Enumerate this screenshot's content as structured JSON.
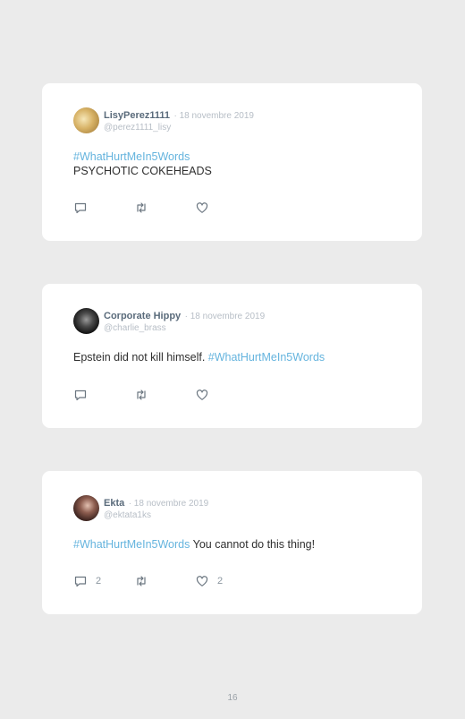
{
  "tweets": [
    {
      "name": "LisyPerez1111",
      "date": "· 18 novembre 2019",
      "handle": "@perez1111_lisy",
      "hashtag": "#WhatHurtMeIn5Words",
      "text": "PSYCHOTIC COKEHEADS",
      "reply_count": "",
      "like_count": ""
    },
    {
      "name": "Corporate Hippy",
      "date": "· 18 novembre 2019",
      "handle": "@charlie_brass",
      "text": "Epstein did not kill himself.",
      "hashtag": "#WhatHurtMeIn5Words",
      "reply_count": "",
      "like_count": ""
    },
    {
      "name": "Ekta",
      "date": "· 18 novembre 2019",
      "handle": "@ektata1ks",
      "hashtag": "#WhatHurtMeIn5Words",
      "text": "You cannot do this thing!",
      "reply_count": "2",
      "like_count": "2"
    }
  ],
  "icons": {
    "reply": "reply-icon",
    "retweet": "retweet-icon",
    "like": "like-icon"
  },
  "colors": {
    "background": "#ebebeb",
    "card": "#ffffff",
    "hashtag": "#65b4de",
    "name": "#5a6b7b",
    "muted": "#b7bec6"
  },
  "page": {
    "number": "16"
  }
}
